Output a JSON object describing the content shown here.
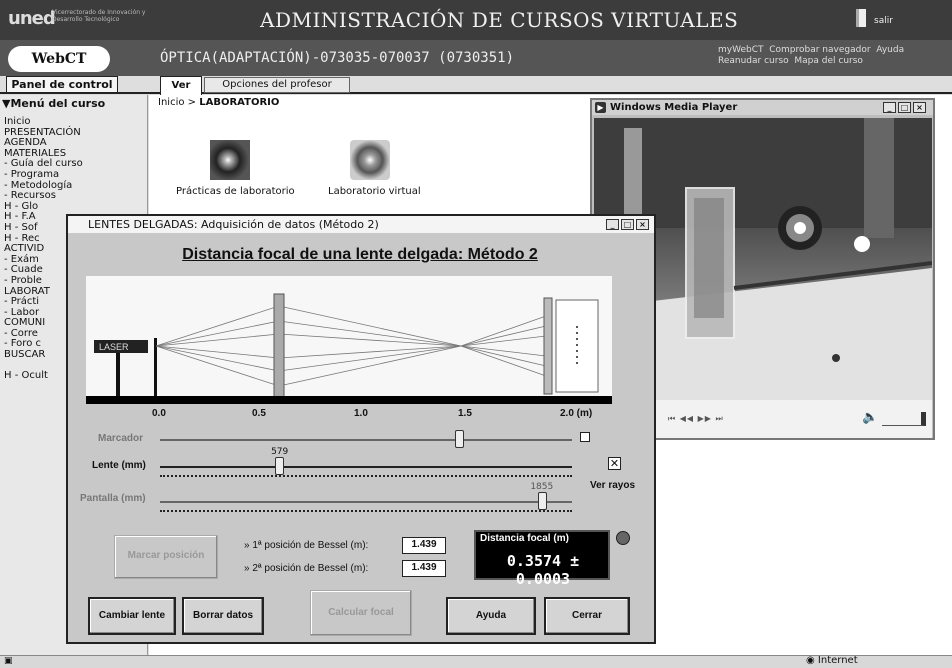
{
  "header": {
    "logo": "uned",
    "logo_sub": "Vicerrectorado de Innovación y Desarrollo Tecnológico",
    "site_title": "ADMINISTRACIÓN DE CURSOS VIRTUALES",
    "exit_label": "salir"
  },
  "course": {
    "brand": "WebCT",
    "title": "ÓPTICA(ADAPTACIÓN)-073035-070037 (0730351)",
    "links": [
      "myWebCT",
      "Comprobar navegador",
      "Ayuda",
      "Reanudar curso",
      "Mapa del curso"
    ]
  },
  "tabs": {
    "panel": "Panel de control",
    "ver": "Ver",
    "opciones": "Opciones del profesor"
  },
  "sidebar": {
    "heading": "▼Menú del curso",
    "items": [
      "Inicio",
      "PRESENTACIÓN",
      "AGENDA",
      "MATERIALES",
      " - Guía del curso",
      " - Programa",
      " - Metodología",
      " - Recursos",
      "H - Glo",
      "H - F.A",
      "H - Sof",
      "H - Rec",
      "ACTIVID",
      " - Exám",
      " - Cuade",
      " - Proble",
      "LABORAT",
      " - Prácti",
      " - Labor",
      "COMUNI",
      " - Corre",
      " - Foro c",
      "BUSCAR",
      "",
      "H - Ocult"
    ]
  },
  "content": {
    "breadcrumb_home": "Inicio",
    "breadcrumb_sep": " > ",
    "breadcrumb_current": "LABORATORIO",
    "tile1": "Prácticas de laboratorio",
    "tile2": "Laboratorio virtual"
  },
  "media_player": {
    "title": "Windows Media Player",
    "transport": "⏮ ◀◀ ▶▶ ⏭"
  },
  "dialog": {
    "title": "LENTES DELGADAS: Adquisición de datos (Método 2)",
    "heading": "Distancia focal de una lente delgada: Método 2",
    "laser_label": "LASER",
    "axis_ticks": [
      "0.0",
      "0.5",
      "1.0",
      "1.5",
      "2.0 (m)"
    ],
    "marcador_label": "Marcador",
    "marcador_check": "",
    "lente_label": "Lente (mm)",
    "lente_value": "579",
    "lente_fraction": 0.289,
    "pantalla_label": "Pantalla (mm)",
    "pantalla_value": "1855",
    "pantalla_fraction": 0.928,
    "marcador_fraction": 0.725,
    "ver_rayos_label": "Ver rayos",
    "ver_rayos_checked": true,
    "marcar_btn": "Marcar posición",
    "bessel1_label": "» 1ª posición de Bessel (m):",
    "bessel1_value": "1.439",
    "bessel2_label": "» 2ª posición de Bessel (m):",
    "bessel2_value": "1.439",
    "focal_label": "Distancia focal (m)",
    "focal_value": "0.3574 ± 0.0003",
    "buttons": {
      "cambiar": "Cambiar lente",
      "borrar": "Borrar datos",
      "calcular": "Calcular focal",
      "ayuda": "Ayuda",
      "cerrar": "Cerrar"
    }
  },
  "status": {
    "zone": "Internet"
  }
}
